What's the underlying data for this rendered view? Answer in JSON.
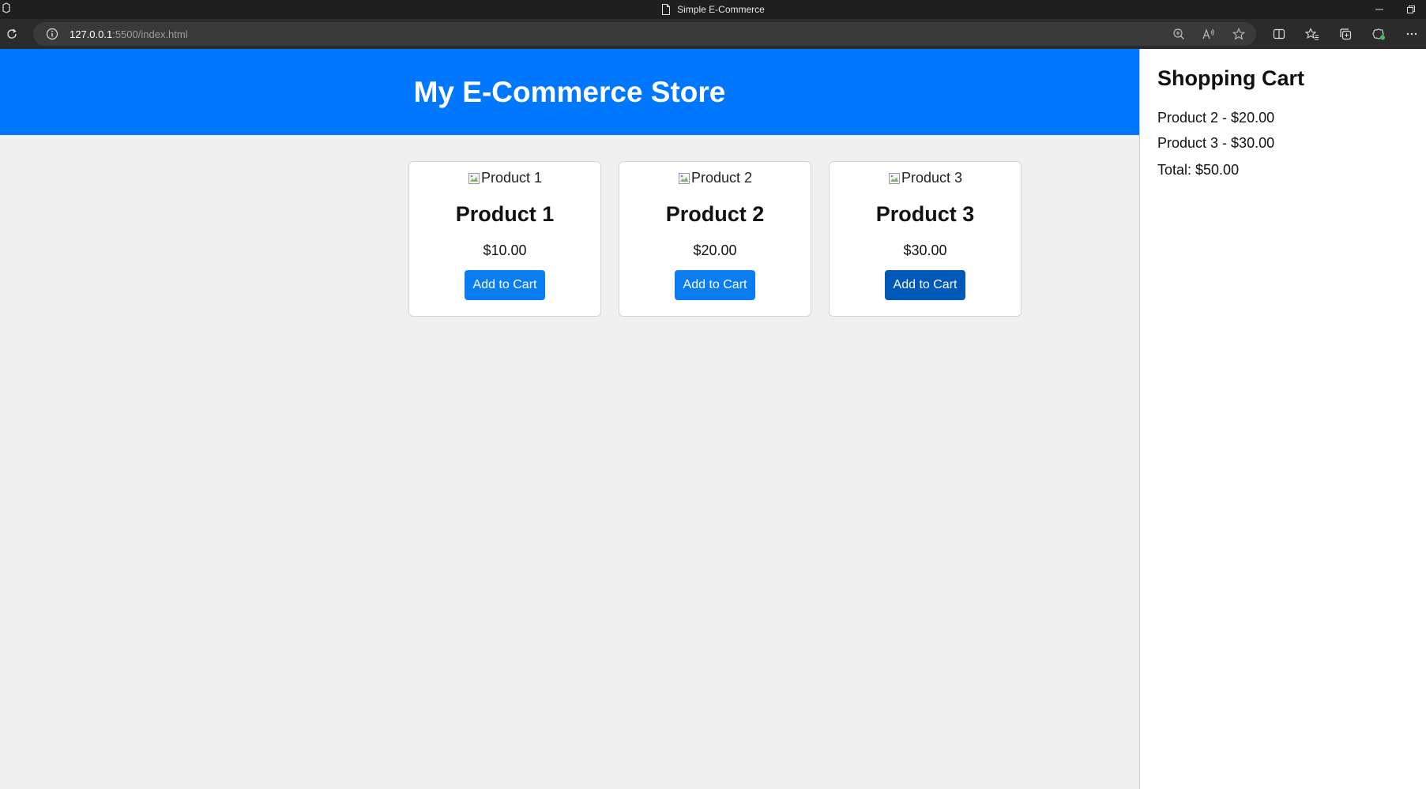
{
  "window": {
    "title": "Simple E-Commerce"
  },
  "browser": {
    "url_host": "127.0.0.1",
    "url_path": ":5500/index.html"
  },
  "header": {
    "title": "My E-Commerce Store",
    "color": "#0077ff"
  },
  "products": [
    {
      "img_alt": "Product 1",
      "name": "Product 1",
      "price": "$10.00",
      "button_label": "Add to Cart"
    },
    {
      "img_alt": "Product 2",
      "name": "Product 2",
      "price": "$20.00",
      "button_label": "Add to Cart"
    },
    {
      "img_alt": "Product 3",
      "name": "Product 3",
      "price": "$30.00",
      "button_label": "Add to Cart"
    }
  ],
  "cart": {
    "title": "Shopping Cart",
    "items": [
      "Product 2 - $20.00",
      "Product 3 - $30.00"
    ],
    "total": "Total: $50.00"
  },
  "icons": {
    "app": "app-icon",
    "document": "document-icon",
    "reload": "reload-icon",
    "site_info": "info-icon",
    "zoom": "zoom-icon",
    "read_aloud": "read-aloud-icon",
    "favorite": "star-icon",
    "split_screen": "split-screen-icon",
    "favorites": "favorites-icon",
    "collections": "collections-icon",
    "extensions": "extensions-icon",
    "more": "more-icon"
  }
}
